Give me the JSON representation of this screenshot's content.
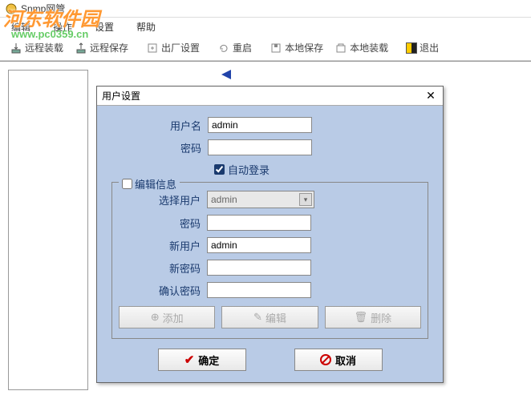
{
  "window": {
    "title": "Snmp网管"
  },
  "menu": {
    "items": [
      "编辑",
      "操作",
      "设置",
      "帮助"
    ]
  },
  "toolbar": {
    "remote_load": "远程装载",
    "remote_save": "远程保存",
    "factory": "出厂设置",
    "restart": "重启",
    "local_save": "本地保存",
    "local_load": "本地装载",
    "exit": "退出"
  },
  "watermark": {
    "main": "河东软件园",
    "sub": "www.pc0359.cn"
  },
  "dialog": {
    "title": "用户设置",
    "username_label": "用户名",
    "username_value": "admin",
    "password_label": "密码",
    "autologin_label": "自动登录",
    "autologin_checked": true,
    "fieldset": {
      "legend": "编辑信息",
      "legend_checked": false,
      "select_user_label": "选择用户",
      "select_user_value": "admin",
      "password_label": "密码",
      "newuser_label": "新用户",
      "newuser_value": "admin",
      "newpassword_label": "新密码",
      "confirmpassword_label": "确认密码",
      "add_btn": "添加",
      "edit_btn": "编辑",
      "delete_btn": "删除"
    },
    "ok": "确定",
    "cancel": "取消"
  }
}
